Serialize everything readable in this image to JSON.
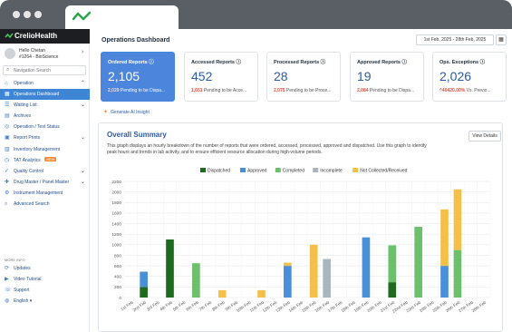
{
  "browser": {
    "tab_logo": "crelio-check-icon"
  },
  "sidebar": {
    "brand": "CrelioHealth",
    "user_name": "Hello Chetan",
    "user_org": "#1264 - BioScience",
    "search_placeholder": "Navigation Search",
    "items": [
      {
        "label": "Operation",
        "icon": "home-icon",
        "chevron": "⌃",
        "active": false
      },
      {
        "label": "Operations Dashboard",
        "icon": "dashboard-icon",
        "chevron": "",
        "active": true
      },
      {
        "label": "Waiting List",
        "icon": "list-icon",
        "chevron": "⌄",
        "active": false
      },
      {
        "label": "Archives",
        "icon": "archive-icon",
        "chevron": "",
        "active": false
      },
      {
        "label": "Operation / Test Status",
        "icon": "status-icon",
        "chevron": "",
        "active": false
      },
      {
        "label": "Report Prints",
        "icon": "print-icon",
        "chevron": "⌄",
        "active": false
      },
      {
        "label": "Inventory Management",
        "icon": "inventory-icon",
        "chevron": "",
        "active": false
      },
      {
        "label": "TAT Analytics",
        "icon": "clock-icon",
        "chevron": "",
        "badge": "NEW",
        "active": false
      },
      {
        "label": "Quality Control",
        "icon": "quality-icon",
        "chevron": "⌄",
        "active": false
      },
      {
        "label": "Drug Master / Panel Master",
        "icon": "drug-icon",
        "chevron": "⌄",
        "active": false
      },
      {
        "label": "Instrument Management",
        "icon": "instrument-icon",
        "chevron": "",
        "active": false
      },
      {
        "label": "Advanced Search",
        "icon": "search-icon",
        "chevron": "",
        "active": false
      }
    ],
    "more_info": "MORE INFO",
    "footer": [
      {
        "label": "Updates",
        "icon": "updates-icon"
      },
      {
        "label": "Video Tutorial",
        "icon": "video-icon"
      },
      {
        "label": "Support",
        "icon": "support-icon"
      },
      {
        "label": "English",
        "icon": "globe-icon"
      }
    ]
  },
  "header": {
    "title": "Operations Dashboard",
    "date_range": "1st Feb, 2025 - 28th Feb, 2025"
  },
  "cards": [
    {
      "title": "Ordered Reports",
      "value": "2,105",
      "sub_num": "2,029",
      "sub_text": "Pending to be Dispa...",
      "active": true
    },
    {
      "title": "Accessed Reports",
      "value": "452",
      "sub_num": "1,651",
      "sub_text": "Pending to be Acce...",
      "active": false
    },
    {
      "title": "Processed Reports",
      "value": "28",
      "sub_num": "2,075",
      "sub_text": "Pending to be Proce...",
      "active": false
    },
    {
      "title": "Approved Reports",
      "value": "19",
      "sub_num": "2,084",
      "sub_text": "Pending to be Dispa...",
      "active": false
    },
    {
      "title": "Ops. Exceptions",
      "value": "2,026",
      "sub_num": "^40420.00%",
      "sub_text": "Vs. Previo...",
      "active": false
    }
  ],
  "ai_insight": "Generate AI Insight",
  "summary": {
    "title": "Overall Summary",
    "description": "This graph displays an hourly breakdown of the number of reports that were ordered, accessed, processed, approved and dispatched. Use this graph to identify peak hours and trends in lab activity, and to ensure efficient resource allocation during high-volume periods.",
    "view_details": "View Details"
  },
  "chart_data": {
    "type": "bar",
    "stacked": true,
    "legend_position": "top",
    "grid": true,
    "ylim": [
      0,
      2200
    ],
    "yticks": [
      0,
      200,
      400,
      600,
      800,
      1000,
      1200,
      1400,
      1600,
      1800,
      2000,
      2200
    ],
    "categories": [
      "1st Feb",
      "2nd Feb",
      "3rd Feb",
      "4th Feb",
      "5th Feb",
      "6th Feb",
      "7th Feb",
      "8th Feb",
      "9th Feb",
      "10th Feb",
      "11th Feb",
      "12th Feb",
      "13th Feb",
      "14th Feb",
      "15th Feb",
      "16th Feb",
      "17th Feb",
      "18th Feb",
      "19th Feb",
      "20th Feb",
      "21st Feb",
      "22nd Feb",
      "23rd Feb",
      "24th Feb",
      "25th Feb",
      "26th Feb",
      "27th Feb",
      "28th Feb"
    ],
    "series": [
      {
        "name": "Dispatched",
        "color": "#1e6b1e",
        "values": [
          0,
          200,
          0,
          1100,
          0,
          0,
          0,
          0,
          0,
          0,
          0,
          0,
          0,
          0,
          0,
          0,
          0,
          0,
          0,
          0,
          290,
          0,
          0,
          0,
          0,
          0,
          0,
          0
        ]
      },
      {
        "name": "Approved",
        "color": "#4a90d9",
        "values": [
          0,
          290,
          0,
          0,
          0,
          0,
          0,
          0,
          0,
          0,
          0,
          0,
          600,
          0,
          0,
          0,
          0,
          0,
          1140,
          0,
          0,
          0,
          0,
          0,
          600,
          0,
          0,
          0
        ]
      },
      {
        "name": "Completed",
        "color": "#6cc06c",
        "values": [
          0,
          0,
          0,
          0,
          0,
          650,
          0,
          0,
          0,
          0,
          0,
          0,
          0,
          0,
          0,
          0,
          0,
          0,
          0,
          0,
          700,
          0,
          1340,
          0,
          0,
          900,
          0,
          0
        ]
      },
      {
        "name": "Incomplete",
        "color": "#a9b6bf",
        "values": [
          0,
          0,
          0,
          0,
          0,
          0,
          0,
          0,
          0,
          0,
          0,
          0,
          0,
          0,
          0,
          730,
          0,
          0,
          0,
          0,
          0,
          0,
          0,
          0,
          0,
          0,
          0,
          0
        ]
      },
      {
        "name": "Not Collected/Received",
        "color": "#f5c04a",
        "values": [
          0,
          0,
          0,
          0,
          0,
          0,
          0,
          140,
          0,
          0,
          140,
          0,
          60,
          0,
          1000,
          0,
          0,
          0,
          0,
          0,
          0,
          0,
          0,
          0,
          1070,
          1150,
          0,
          0
        ]
      }
    ]
  }
}
